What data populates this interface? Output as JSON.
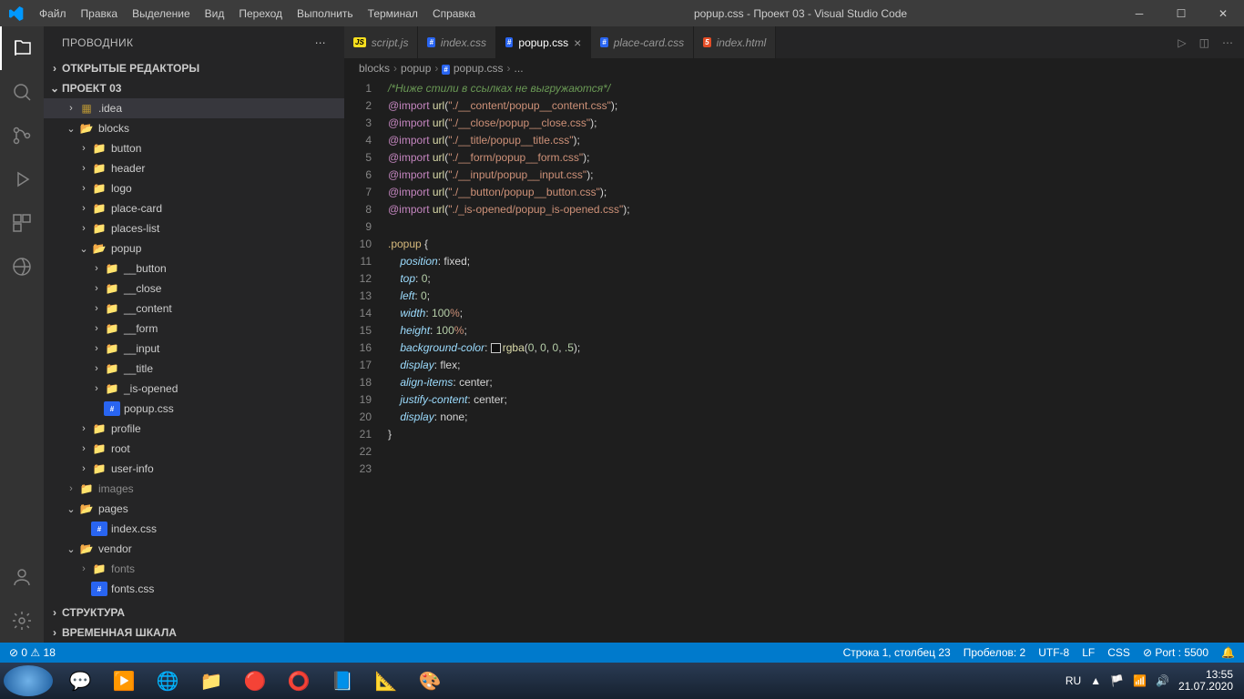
{
  "titlebar": {
    "menu": [
      "Файл",
      "Правка",
      "Выделение",
      "Вид",
      "Переход",
      "Выполнить",
      "Терминал",
      "Справка"
    ],
    "title": "popup.css - Проект 03 - Visual Studio Code"
  },
  "sidebar": {
    "title": "ПРОВОДНИК",
    "sections": {
      "open_editors": "ОТКРЫТЫЕ РЕДАКТОРЫ",
      "project": "ПРОЕКТ 03",
      "outline": "СТРУКТУРА",
      "timeline": "ВРЕМЕННАЯ ШКАЛА"
    },
    "tree": [
      {
        "label": ".idea",
        "depth": 1,
        "icon": "idea",
        "chev": ">",
        "selected": true
      },
      {
        "label": "blocks",
        "depth": 1,
        "icon": "folder-open",
        "chev": "v"
      },
      {
        "label": "button",
        "depth": 2,
        "icon": "folder",
        "chev": ">"
      },
      {
        "label": "header",
        "depth": 2,
        "icon": "folder",
        "chev": ">"
      },
      {
        "label": "logo",
        "depth": 2,
        "icon": "folder",
        "chev": ">"
      },
      {
        "label": "place-card",
        "depth": 2,
        "icon": "folder",
        "chev": ">"
      },
      {
        "label": "places-list",
        "depth": 2,
        "icon": "folder",
        "chev": ">"
      },
      {
        "label": "popup",
        "depth": 2,
        "icon": "folder-open",
        "chev": "v"
      },
      {
        "label": "__button",
        "depth": 3,
        "icon": "folder",
        "chev": ">"
      },
      {
        "label": "__close",
        "depth": 3,
        "icon": "folder",
        "chev": ">"
      },
      {
        "label": "__content",
        "depth": 3,
        "icon": "folder",
        "chev": ">"
      },
      {
        "label": "__form",
        "depth": 3,
        "icon": "folder",
        "chev": ">"
      },
      {
        "label": "__input",
        "depth": 3,
        "icon": "folder",
        "chev": ">"
      },
      {
        "label": "__title",
        "depth": 3,
        "icon": "folder",
        "chev": ">"
      },
      {
        "label": "_is-opened",
        "depth": 3,
        "icon": "folder",
        "chev": ">"
      },
      {
        "label": "popup.css",
        "depth": 3,
        "icon": "css",
        "chev": ""
      },
      {
        "label": "profile",
        "depth": 2,
        "icon": "folder",
        "chev": ">"
      },
      {
        "label": "root",
        "depth": 2,
        "icon": "folder",
        "chev": ">"
      },
      {
        "label": "user-info",
        "depth": 2,
        "icon": "folder",
        "chev": ">"
      },
      {
        "label": "images",
        "depth": 1,
        "icon": "folder",
        "chev": ">",
        "dim": true
      },
      {
        "label": "pages",
        "depth": 1,
        "icon": "folder-open",
        "chev": "v"
      },
      {
        "label": "index.css",
        "depth": 2,
        "icon": "css",
        "chev": ""
      },
      {
        "label": "vendor",
        "depth": 1,
        "icon": "folder-open",
        "chev": "v"
      },
      {
        "label": "fonts",
        "depth": 2,
        "icon": "folder",
        "chev": ">",
        "dim": true
      },
      {
        "label": "fonts.css",
        "depth": 2,
        "icon": "css",
        "chev": ""
      }
    ]
  },
  "tabs": [
    {
      "label": "script.js",
      "icon": "js"
    },
    {
      "label": "index.css",
      "icon": "css"
    },
    {
      "label": "popup.css",
      "icon": "css",
      "active": true
    },
    {
      "label": "place-card.css",
      "icon": "css"
    },
    {
      "label": "index.html",
      "icon": "html"
    }
  ],
  "breadcrumbs": [
    "blocks",
    "popup",
    "popup.css",
    "..."
  ],
  "code": {
    "lines": 23,
    "l1_comment": "/*Ниже стили в ссылках не выгружаются*/",
    "imports": [
      "\"./__content/popup__content.css\"",
      "\"./__close/popup__close.css\"",
      "\"./__title/popup__title.css\"",
      "\"./__form/popup__form.css\"",
      "\"./__input/popup__input.css\"",
      "\"./__button/popup__button.css\"",
      "\"./_is-opened/popup_is-opened.css\""
    ],
    "selector": ".popup",
    "props": [
      {
        "p": "position",
        "v": "fixed"
      },
      {
        "p": "top",
        "v": "0",
        "num": true
      },
      {
        "p": "left",
        "v": "0",
        "num": true
      },
      {
        "p": "width",
        "v": "100%",
        "pct": true
      },
      {
        "p": "height",
        "v": "100%",
        "pct": true
      },
      {
        "p": "background-color",
        "v": "rgba(0, 0, 0, .5)",
        "rgba": true
      },
      {
        "p": "display",
        "v": "flex"
      },
      {
        "p": "align-items",
        "v": "center"
      },
      {
        "p": "justify-content",
        "v": "center"
      },
      {
        "p": "display",
        "v": "none"
      }
    ]
  },
  "statusbar": {
    "errors": "0",
    "warnings": "18",
    "position": "Строка 1, столбец 23",
    "spaces": "Пробелов: 2",
    "encoding": "UTF-8",
    "eol": "LF",
    "lang": "CSS",
    "port": "Port : 5500"
  },
  "taskbar": {
    "lang": "RU",
    "time": "13:55",
    "date": "21.07.2020"
  }
}
